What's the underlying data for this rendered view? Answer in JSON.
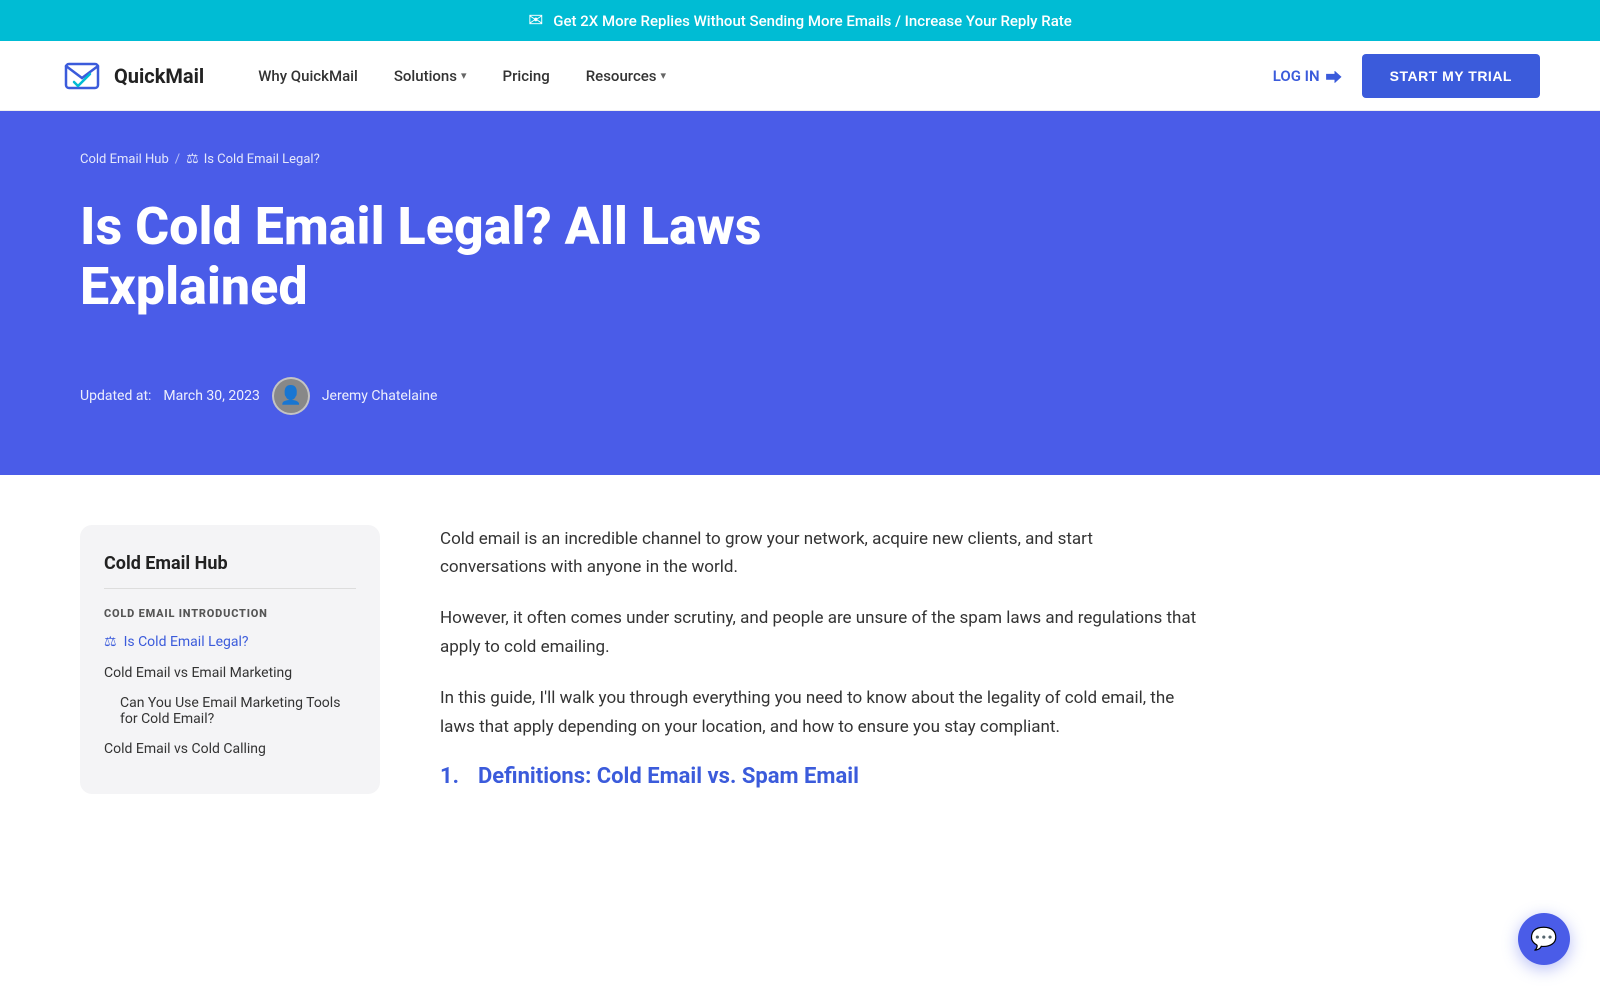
{
  "banner": {
    "icon": "✉",
    "text": "Get 2X More Replies Without Sending More Emails / Increase Your Reply Rate"
  },
  "nav": {
    "logo_text": "QuickMail",
    "links": [
      {
        "label": "Why QuickMail",
        "has_dropdown": false
      },
      {
        "label": "Solutions",
        "has_dropdown": true
      },
      {
        "label": "Pricing",
        "has_dropdown": false
      },
      {
        "label": "Resources",
        "has_dropdown": true
      }
    ],
    "login_label": "LOG IN",
    "trial_label": "START MY TRIAL"
  },
  "breadcrumb": {
    "parent": "Cold Email Hub",
    "separator": "/",
    "current_icon": "⚖",
    "current": "Is Cold Email Legal?"
  },
  "hero": {
    "title": "Is Cold Email Legal? All Laws Explained",
    "updated_label": "Updated at:",
    "updated_date": "March 30, 2023",
    "author": "Jeremy Chatelaine"
  },
  "sidebar": {
    "title": "Cold Email Hub",
    "section_label": "COLD EMAIL INTRODUCTION",
    "active_link_icon": "⚖",
    "active_link": "Is Cold Email Legal?",
    "items": [
      {
        "label": "Cold Email vs Email Marketing",
        "indented": false
      },
      {
        "label": "Can You Use Email Marketing Tools for Cold Email?",
        "indented": true
      },
      {
        "label": "Cold Email vs Cold Calling",
        "indented": false
      }
    ]
  },
  "article": {
    "para1": "Cold email is an incredible channel to grow your network, acquire new clients, and start conversations with anyone in the world.",
    "para2": "However, it often comes under scrutiny, and people are unsure of the spam laws and regulations that apply to cold emailing.",
    "para3": "In this guide, I'll walk you through everything you need to know about the legality of cold email, the laws that apply depending on your location, and how to ensure you stay compliant.",
    "heading1_num": "1.",
    "heading1_text": "Definitions: Cold Email vs. Spam Email"
  },
  "chat": {
    "icon": "💬"
  }
}
